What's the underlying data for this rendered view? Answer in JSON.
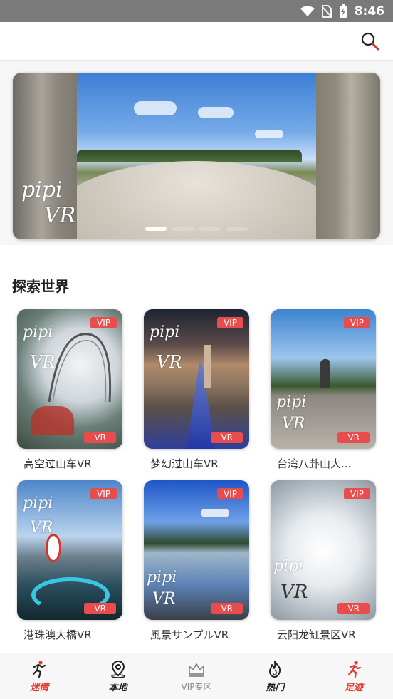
{
  "status_bar": {
    "time": "8:46"
  },
  "banner": {
    "watermark_line1": "pipi",
    "watermark_line2": "VR",
    "slide_count": 4,
    "active_slide": 0
  },
  "section": {
    "title": "探索世界"
  },
  "badges": {
    "vip": "VIP",
    "vr": "VR"
  },
  "cards": [
    {
      "title": "高空过山车VR"
    },
    {
      "title": "梦幻过山车VR"
    },
    {
      "title": "台湾八卦山大..."
    },
    {
      "title": "港珠澳大橋VR"
    },
    {
      "title": "風景サンプルVR"
    },
    {
      "title": "云阳龙缸景区VR"
    }
  ],
  "nav": [
    {
      "label": "迷情",
      "icon": "runner-icon",
      "active": true
    },
    {
      "label": "本地",
      "icon": "location-pin-icon",
      "active": false
    },
    {
      "label": "VIP专区",
      "icon": "crown-icon",
      "active": false
    },
    {
      "label": "热门",
      "icon": "flame-icon",
      "active": false
    },
    {
      "label": "足迹",
      "icon": "footprint-runner-icon",
      "active": false
    }
  ],
  "colors": {
    "accent": "#e94c4c",
    "nav_red": "#e8392f"
  }
}
